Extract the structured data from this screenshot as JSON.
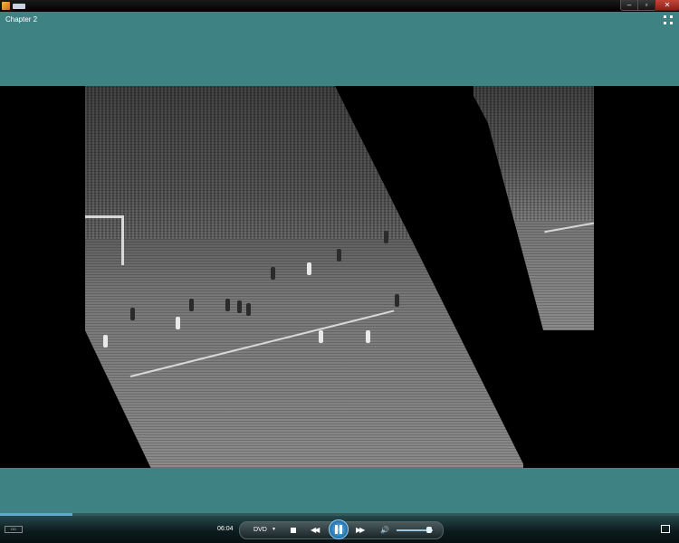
{
  "window": {
    "title_controls": {
      "minimize": "–",
      "maximize": "▫",
      "close": "✕"
    }
  },
  "header": {
    "chapter_title": "Chapter 2",
    "icons": [
      "app-icon",
      "fullscreen-icon"
    ]
  },
  "video": {
    "content": "black-and-white football footage, rotated transition effect"
  },
  "controls": {
    "time": "06:04",
    "dvd_label": "DVD",
    "dvd_arrow": "▼",
    "prev_glyph": "◀◀",
    "next_glyph": "▶▶",
    "volume_glyph": "🔊",
    "seek_progress": 0.106,
    "volume_level": 0.9,
    "colors": {
      "accent": "#5fa7d6",
      "teal": "#3e8284"
    },
    "icons": [
      "dolby-logo",
      "stop-icon",
      "previous-icon",
      "pause-icon",
      "next-icon",
      "volume-icon",
      "switch-to-library-icon"
    ]
  }
}
